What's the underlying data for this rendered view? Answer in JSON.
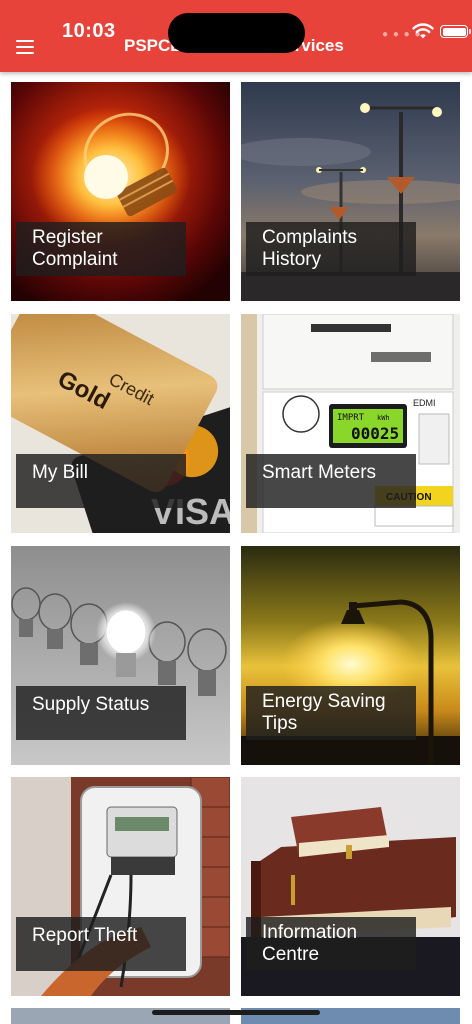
{
  "status_bar": {
    "time": "10:03"
  },
  "app_bar": {
    "title": "PSPCL Consumer Services"
  },
  "tiles": [
    {
      "line1": "Register",
      "line2": "Complaint"
    },
    {
      "line1": "Complaints",
      "line2": "History"
    },
    {
      "line1": "My Bill",
      "line2": ""
    },
    {
      "line1": "Smart Meters",
      "line2": ""
    },
    {
      "line1": "Supply Status",
      "line2": ""
    },
    {
      "line1": "Energy Saving",
      "line2": "Tips"
    },
    {
      "line1": "Report Theft",
      "line2": ""
    },
    {
      "line1": "Information",
      "line2": "Centre"
    }
  ],
  "card_text": {
    "credit": "Credit",
    "gold": "Gold",
    "visa": "VISA"
  },
  "meter_text": {
    "brand": "EDMI",
    "impr": "IMPRT",
    "kwh": "kWh",
    "reading": "00025",
    "caution": "CAUTION"
  },
  "colors": {
    "app_bar": "#e8433b",
    "label_bg": "#1e1e1e"
  }
}
